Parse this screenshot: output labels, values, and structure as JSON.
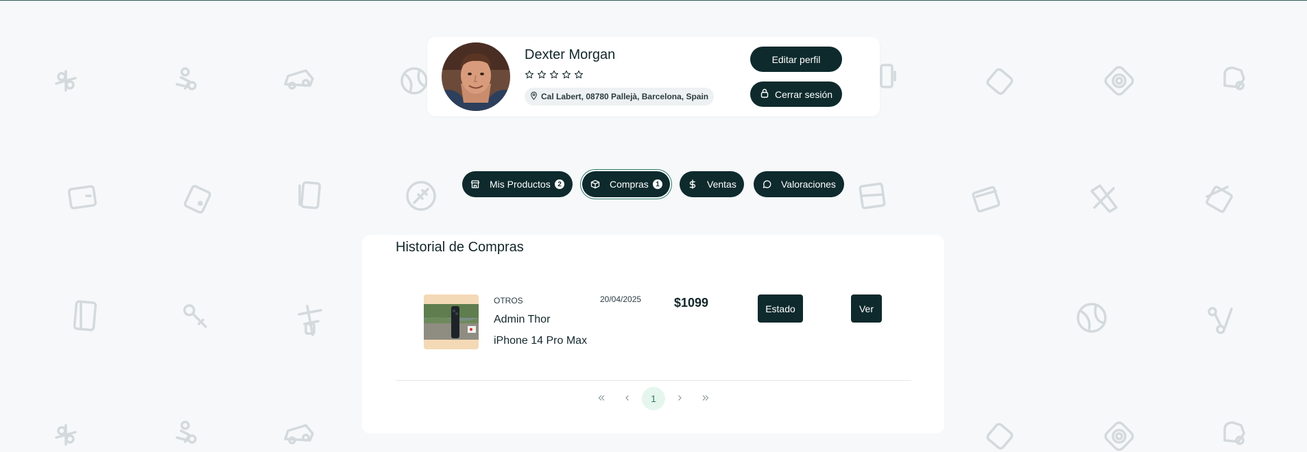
{
  "profile": {
    "name": "Dexter Morgan",
    "rating_value": 0,
    "rating_max": 5,
    "location": "Cal Labert, 08780 Pallejà, Barcelona, Spain",
    "edit_label": "Editar perfil",
    "logout_label": "Cerrar sesión"
  },
  "tabs": [
    {
      "label": "Mis Productos",
      "badge": "2",
      "icon": "shop-icon",
      "active": false
    },
    {
      "label": "Compras",
      "badge": "1",
      "icon": "box-icon",
      "active": true
    },
    {
      "label": "Ventas",
      "badge": "",
      "icon": "dollar-icon",
      "active": false
    },
    {
      "label": "Valoraciones",
      "badge": "",
      "icon": "chat-icon",
      "active": false
    }
  ],
  "purchases": {
    "title": "Historial de Compras",
    "items": [
      {
        "category": "OTROS",
        "seller": "Admin Thor",
        "product": "iPhone 14 Pro Max",
        "date": "20/04/2025",
        "price": "$1099",
        "status_label": "Estado",
        "view_label": "Ver"
      }
    ]
  },
  "pagination": {
    "first_icon": "chevrons-left-icon",
    "prev_icon": "chevron-left-icon",
    "current": "1",
    "next_icon": "chevron-right-icon",
    "last_icon": "chevrons-right-icon"
  },
  "colors": {
    "primary": "#0e2a2d",
    "background": "#f6f8f9",
    "active_page_bg": "#e5f6ee",
    "active_page_text": "#2f7a6a"
  }
}
